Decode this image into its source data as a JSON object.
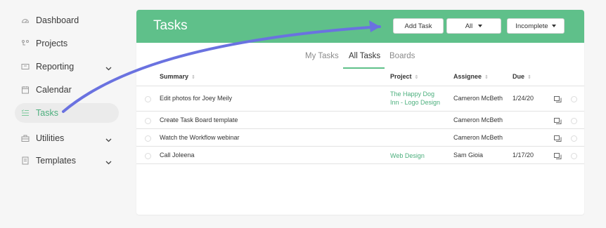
{
  "sidebar": {
    "items": [
      {
        "label": "Dashboard",
        "icon": "dashboard-icon",
        "chevron": false,
        "active": false
      },
      {
        "label": "Projects",
        "icon": "projects-icon",
        "chevron": false,
        "active": false
      },
      {
        "label": "Reporting",
        "icon": "reporting-icon",
        "chevron": true,
        "active": false
      },
      {
        "label": "Calendar",
        "icon": "calendar-icon",
        "chevron": false,
        "active": false
      },
      {
        "label": "Tasks",
        "icon": "tasks-icon",
        "chevron": false,
        "active": true
      },
      {
        "label": "Utilities",
        "icon": "utilities-icon",
        "chevron": true,
        "active": false
      },
      {
        "label": "Templates",
        "icon": "templates-icon",
        "chevron": true,
        "active": false
      }
    ]
  },
  "header": {
    "title": "Tasks",
    "add_task_label": "Add Task",
    "filter_all_label": "All",
    "filter_status_label": "Incomplete"
  },
  "tabs": [
    "My Tasks",
    "All Tasks",
    "Boards"
  ],
  "active_tab": "All Tasks",
  "table": {
    "columns": {
      "summary": "Summary",
      "project": "Project",
      "assignee": "Assignee",
      "due": "Due"
    },
    "rows": [
      {
        "summary": "Edit photos for Joey Meily",
        "project_line1": "The Happy Dog",
        "project_line2": "Inn - Logo Design",
        "assignee": "Cameron McBeth",
        "due": "1/24/20"
      },
      {
        "summary": "Create Task Board template",
        "project_line1": "",
        "project_line2": "",
        "assignee": "Cameron McBeth",
        "due": ""
      },
      {
        "summary": "Watch the Workflow webinar",
        "project_line1": "",
        "project_line2": "",
        "assignee": "Cameron McBeth",
        "due": ""
      },
      {
        "summary": "Call Joleena",
        "project_line1": "Web Design",
        "project_line2": "",
        "assignee": "Sam Gioia",
        "due": "1/17/20"
      }
    ]
  },
  "colors": {
    "accent": "#5fc08a",
    "project_text": "#4caf7d",
    "annotation_arrow": "#6a72e0"
  }
}
